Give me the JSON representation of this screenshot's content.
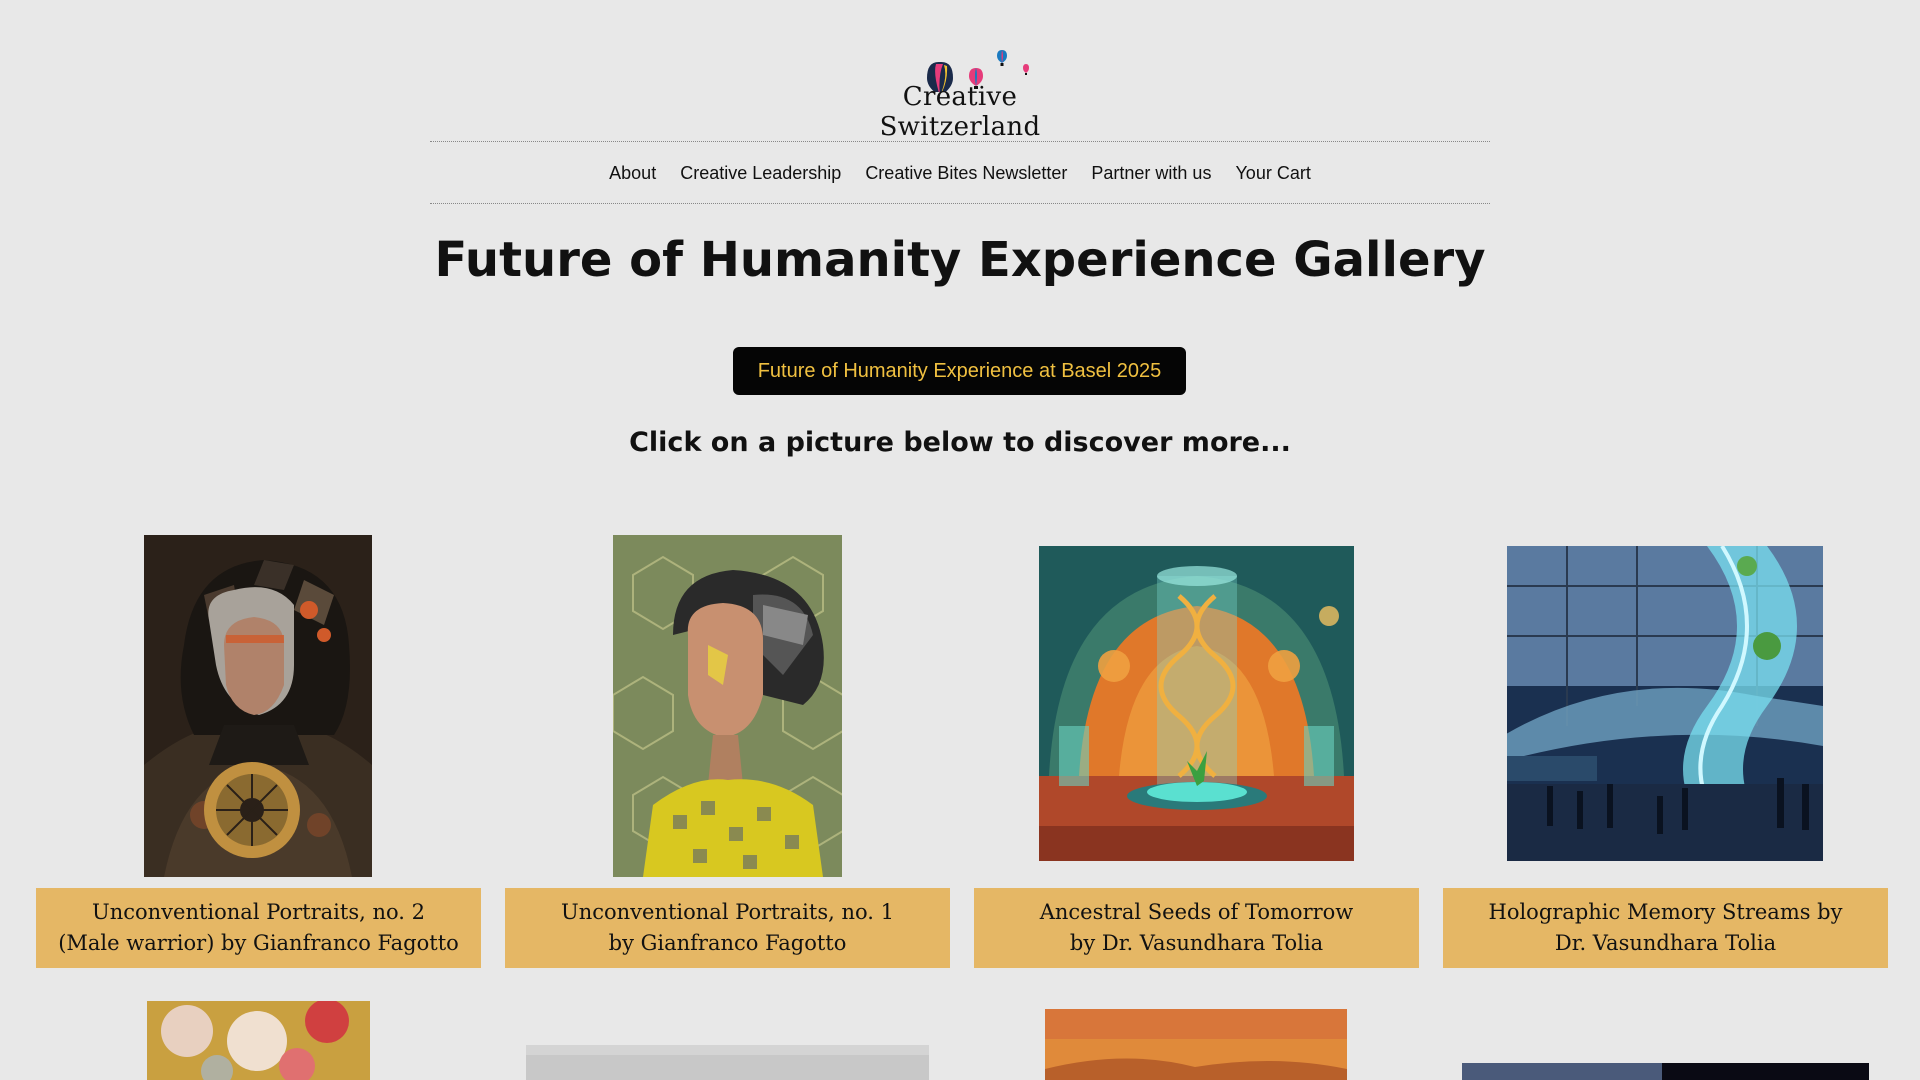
{
  "brand": {
    "name": "Creative Switzerland"
  },
  "nav": {
    "items": [
      {
        "label": "About"
      },
      {
        "label": "Creative Leadership"
      },
      {
        "label": "Creative Bites Newsletter"
      },
      {
        "label": "Partner with us"
      },
      {
        "label": "Your Cart"
      }
    ]
  },
  "page": {
    "title": "Future of Humanity Experience Gallery",
    "cta_label": "Future of Humanity Experience at Basel 2025",
    "subtitle": "Click on a picture below to discover more..."
  },
  "gallery": {
    "items": [
      {
        "line1": "Unconventional Portraits, no. 2",
        "line2": "(Male warrior) by Gianfranco Fagotto",
        "icon": "male-warrior-portrait"
      },
      {
        "line1": "Unconventional Portraits, no. 1",
        "line2": "by Gianfranco Fagotto",
        "icon": "female-portrait"
      },
      {
        "line1": "Ancestral Seeds of Tomorrow",
        "line2": "by Dr. Vasundhara Tolia",
        "icon": "dna-dome-scene"
      },
      {
        "line1": "Holographic Memory Streams by",
        "line2": "Dr. Vasundhara Tolia",
        "icon": "holographic-stream-scene"
      }
    ]
  },
  "colors": {
    "background": "#e8e8e8",
    "caption_bg": "#e5b765",
    "cta_bg": "#050505",
    "cta_text": "#f0c040"
  }
}
